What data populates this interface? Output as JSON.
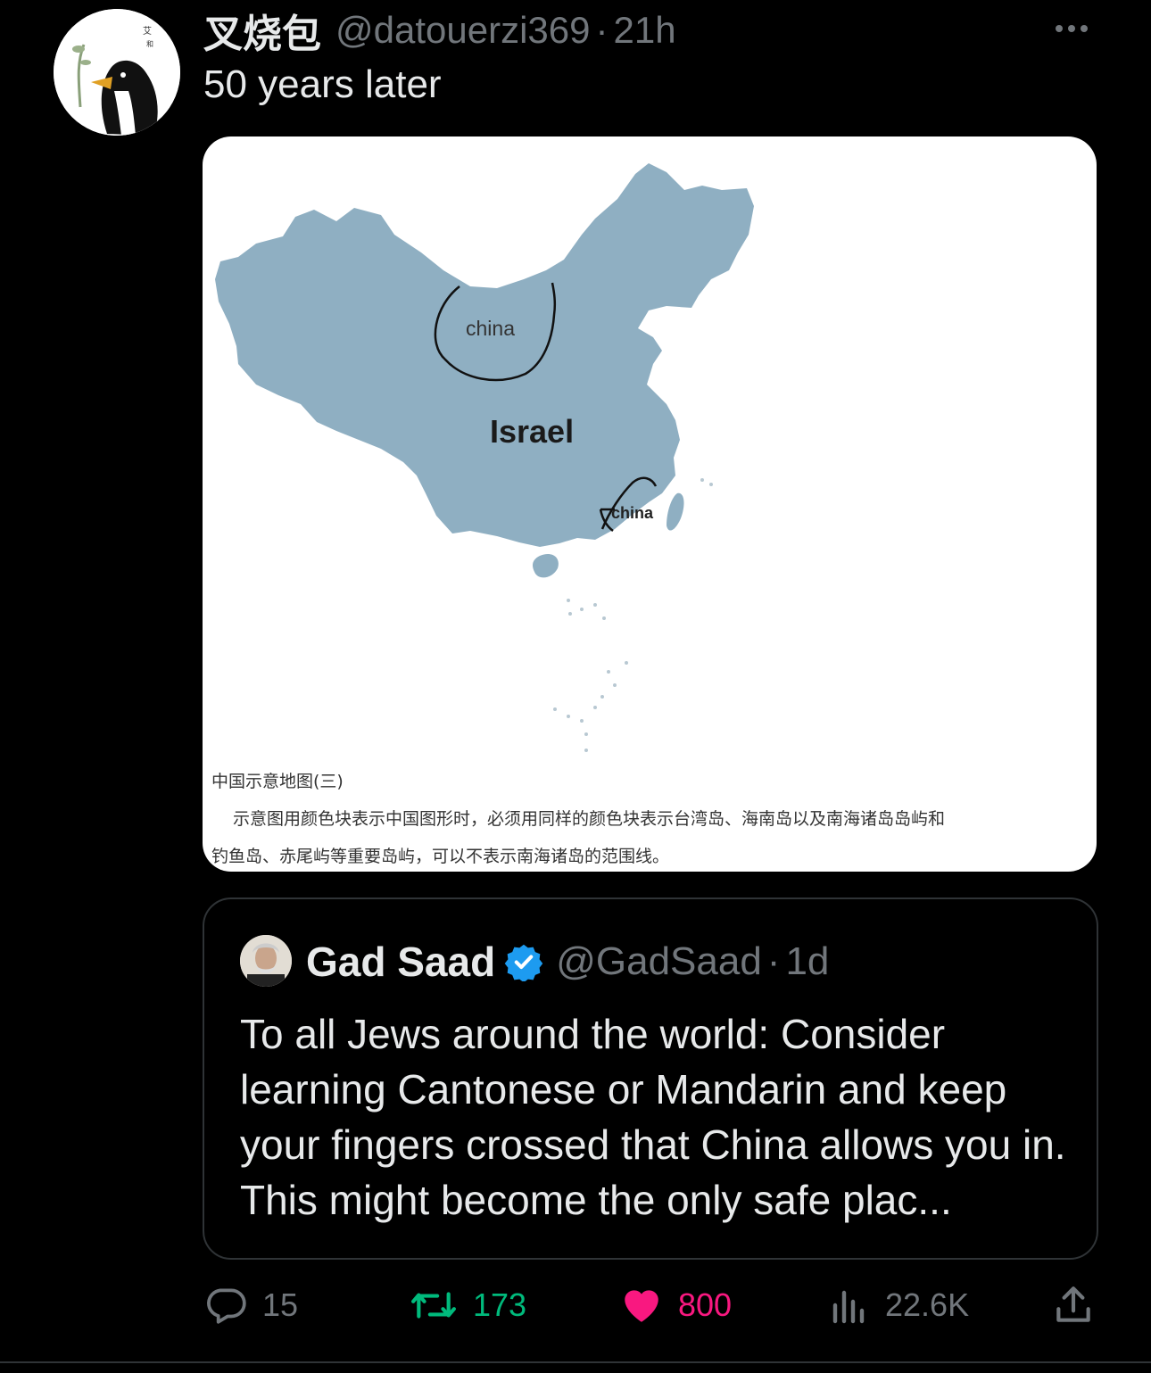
{
  "tweet": {
    "display_name": "叉烧包",
    "handle": "@datouerzi369",
    "separator": "·",
    "time": "21h",
    "text": "50 years later",
    "more_icon": "more-horizontal-icon"
  },
  "media": {
    "map_labels": {
      "top_circle": "china",
      "center": "Israel",
      "bottom_circle": "china"
    },
    "caption_title": "中国示意地图(三)",
    "caption_line1": "示意图用颜色块表示中国图形时，必须用同样的颜色块表示台湾岛、海南岛以及南海诸岛岛屿和",
    "caption_line2": "钓鱼岛、赤尾屿等重要岛屿，可以不表示南海诸岛的范围线。",
    "colors": {
      "land": "#8fafc2",
      "background": "#ffffff"
    }
  },
  "quote": {
    "display_name": "Gad Saad",
    "verified_icon": "verified-badge-icon",
    "handle": "@GadSaad",
    "separator": "·",
    "time": "1d",
    "text": "To all Jews around the world:  Consider learning Cantonese or Mandarin and keep your fingers crossed that China allows you in.  This might become the only safe plac..."
  },
  "actions": {
    "replies": "15",
    "retweets": "173",
    "likes": "800",
    "views": "22.6K"
  },
  "colors": {
    "background": "#000000",
    "text": "#e7e9ea",
    "muted": "#71767b",
    "retweet": "#00ba7c",
    "like": "#f91880",
    "verified": "#1d9bf0"
  }
}
